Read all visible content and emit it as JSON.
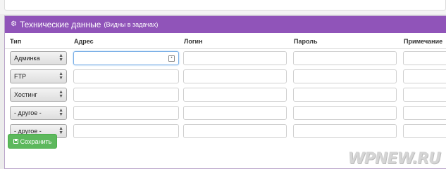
{
  "panel": {
    "title": "Технические данные",
    "subtitle": "(Видны в задачах)",
    "header_color": "#9054b9",
    "icon": "gears-icon"
  },
  "columns": [
    "Тип",
    "Адрес",
    "Логин",
    "Пароль",
    "Примечание"
  ],
  "rows": [
    {
      "type": "Админка"
    },
    {
      "type": "FTP"
    },
    {
      "type": "Хостинг"
    },
    {
      "type": "- другое -"
    },
    {
      "type": "- другое -"
    }
  ],
  "save_button": {
    "label": "Сохранить",
    "icon": "floppy-icon",
    "color": "#5cb85c"
  },
  "watermark": "WPNEW.RU"
}
